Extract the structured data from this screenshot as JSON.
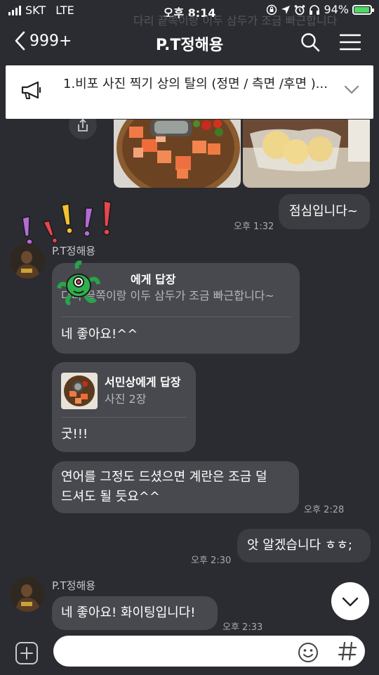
{
  "status_bar": {
    "carrier": "SKT",
    "network": "LTE",
    "time": "오후 8:14",
    "battery": "94%",
    "battery_level": 0.94
  },
  "header": {
    "back_count": "999+",
    "title": "P.T정해용",
    "ghost_text": "다리 끝쪽이랑 이두 삼두가 조금 빠근합니다"
  },
  "notice": {
    "text": "1.비포 사진 찍기 상의 탈의 (정면 / 측면 /후면 )..."
  },
  "messages": {
    "m1": {
      "text": "점심입니다~",
      "time": "오후 1:32"
    },
    "m2": {
      "sender": "P.T정해용",
      "reply_title": "에게 답장",
      "reply_quote": "다리 끝쪽이랑 이두 삼두가 조금 빠근합니다~",
      "text": "네 좋아요!^^"
    },
    "m3": {
      "reply_title": "서민상에게 답장",
      "reply_quote": "사진 2장",
      "text": "굿!!!"
    },
    "m4": {
      "line1": "연어를 그정도 드셨으면 계란은 조금 덜",
      "line2": "드셔도 될 듯요^^",
      "time": "오후 2:28"
    },
    "m5": {
      "text": "앗 알겠습니다 ㅎㅎ;",
      "time": "오후 2:30"
    },
    "m6": {
      "sender": "P.T정해용",
      "text": "네 좋아요! 화이팅입니다!",
      "time": "오후 2:33"
    }
  },
  "composer": {
    "placeholder": ""
  },
  "colors": {
    "background": "#2b2c31",
    "bubble_in": "#48494f",
    "bubble_out": "#3c3d42",
    "battery_fill": "#4cd964"
  },
  "icons": [
    "back-chevron-icon",
    "search-icon",
    "hamburger-menu-icon",
    "megaphone-icon",
    "chevron-down-icon",
    "share-icon",
    "plus-icon",
    "emoji-icon",
    "hash-icon",
    "scroll-down-icon"
  ]
}
